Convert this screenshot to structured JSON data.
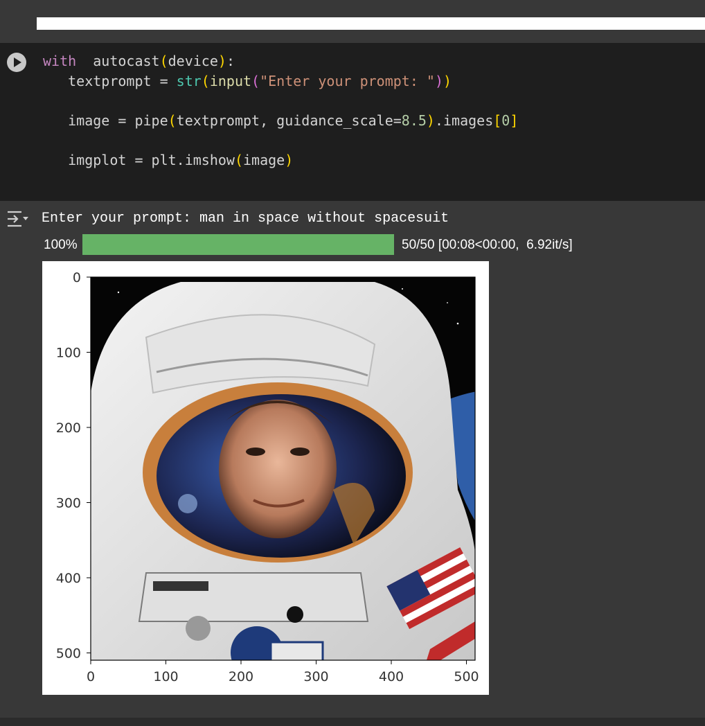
{
  "code_cell": {
    "run_button": "play-icon",
    "lines": [
      [
        [
          "kw",
          "with"
        ],
        [
          "",
          "  autocast"
        ],
        [
          "p1",
          "("
        ],
        [
          "",
          "device"
        ],
        [
          "p1",
          ")"
        ],
        [
          "",
          ":"
        ]
      ],
      [
        [
          "",
          "   textprompt = "
        ],
        [
          "fn",
          "str"
        ],
        [
          "p1",
          "("
        ],
        [
          "fn2",
          "input"
        ],
        [
          "p2",
          "("
        ],
        [
          "str",
          "\"Enter your prompt: \""
        ],
        [
          "p2",
          ")"
        ],
        [
          "p1",
          ")"
        ]
      ],
      [],
      [
        [
          "",
          "   image = pipe"
        ],
        [
          "p1",
          "("
        ],
        [
          "",
          "textprompt, guidance_scale="
        ],
        [
          "num",
          "8.5"
        ],
        [
          "p1",
          ")"
        ],
        [
          "",
          ".images"
        ],
        [
          "p1",
          "["
        ],
        [
          "num",
          "0"
        ],
        [
          "p1",
          "]"
        ]
      ],
      [],
      [
        [
          "",
          "   imgplot = plt.imshow"
        ],
        [
          "p1",
          "("
        ],
        [
          "",
          "image"
        ],
        [
          "p1",
          ")"
        ]
      ]
    ]
  },
  "output": {
    "icon": "output-toggle-icon",
    "prompt_text": "Enter your prompt: man in space without spacesuit",
    "progress": {
      "percent_label": "100%",
      "fraction": 1.0,
      "status": "50/50 [00:08<00:00,  6.92it/s]"
    },
    "figure": {
      "x_ticks": [
        "0",
        "100",
        "200",
        "300",
        "400",
        "500"
      ],
      "y_ticks": [
        "0",
        "100",
        "200",
        "300",
        "400",
        "500"
      ],
      "image": "astronaut-portrait"
    }
  },
  "colors": {
    "cell_bg": "#1e1e1e",
    "output_bg": "#383838",
    "progress": "#66b366"
  }
}
